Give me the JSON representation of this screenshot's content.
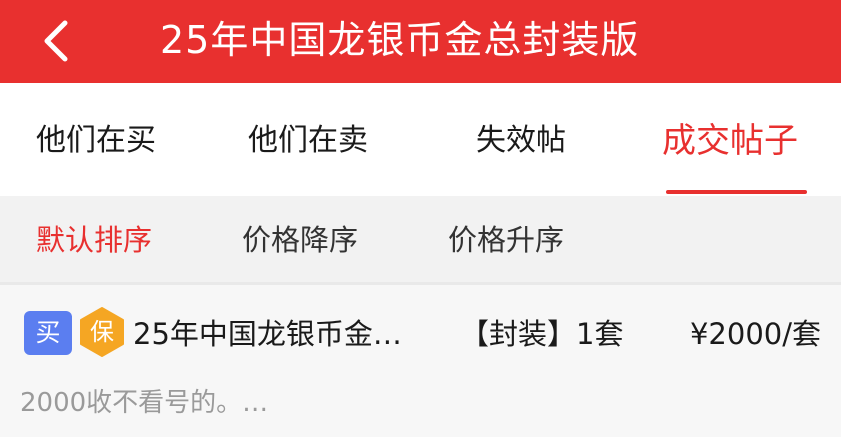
{
  "header": {
    "back_icon": "chevron-left-icon",
    "title": "25年中国龙银币金总封装版"
  },
  "tabs": [
    {
      "label": "他们在买",
      "active": false
    },
    {
      "label": "他们在卖",
      "active": false
    },
    {
      "label": "失效帖",
      "active": false
    },
    {
      "label": "成交帖子",
      "active": true
    }
  ],
  "sort_options": [
    {
      "label": "默认排序",
      "active": true
    },
    {
      "label": "价格降序",
      "active": false
    },
    {
      "label": "价格升序",
      "active": false
    }
  ],
  "listings": [
    {
      "type_badge": "买",
      "guarantee_badge": "保",
      "title": "25年中国龙银币金…",
      "spec": "【封装】1套",
      "price": "¥2000/套",
      "note": "2000收不看号的。…"
    }
  ],
  "colors": {
    "accent": "#e8302f",
    "buy_badge": "#5b7ef0",
    "guarantee_badge": "#f5a623"
  }
}
